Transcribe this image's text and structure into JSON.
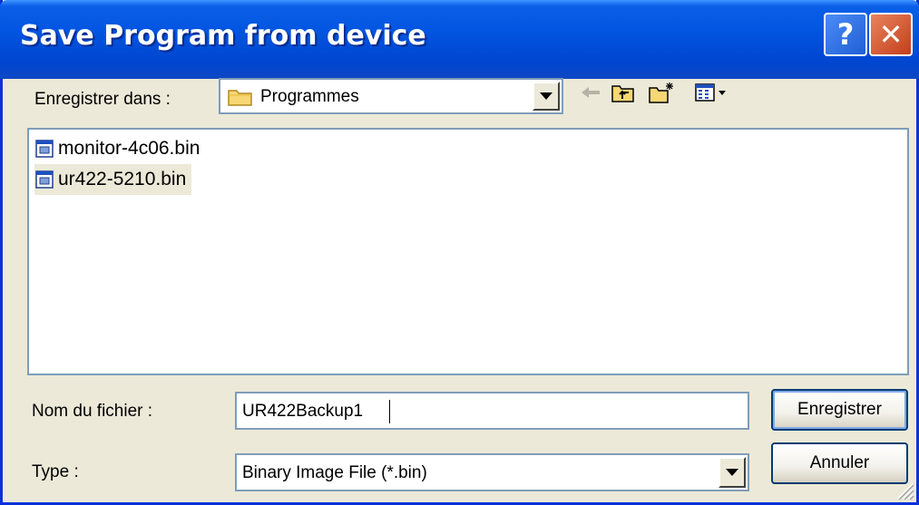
{
  "window": {
    "title": "Save Program from device",
    "help_label": "?",
    "close_label": "✕"
  },
  "location": {
    "label": "Enregistrer dans :",
    "folder": "Programmes"
  },
  "toolbar": {
    "icons": [
      "back-arrow-icon",
      "up-folder-icon",
      "new-folder-icon",
      "view-menu-icon"
    ]
  },
  "files": [
    {
      "name": "monitor-4c06.bin",
      "selected": false
    },
    {
      "name": "ur422-5210.bin",
      "selected": true
    }
  ],
  "filename": {
    "label": "Nom du fichier :",
    "value": "UR422Backup1"
  },
  "filetype": {
    "label": "Type :",
    "value": "Binary Image File (*.bin)"
  },
  "buttons": {
    "save": "Enregistrer",
    "cancel": "Annuler"
  },
  "colors": {
    "titlebar": "#0055E5",
    "close": "#E0562E",
    "face": "#ECE9D8"
  }
}
